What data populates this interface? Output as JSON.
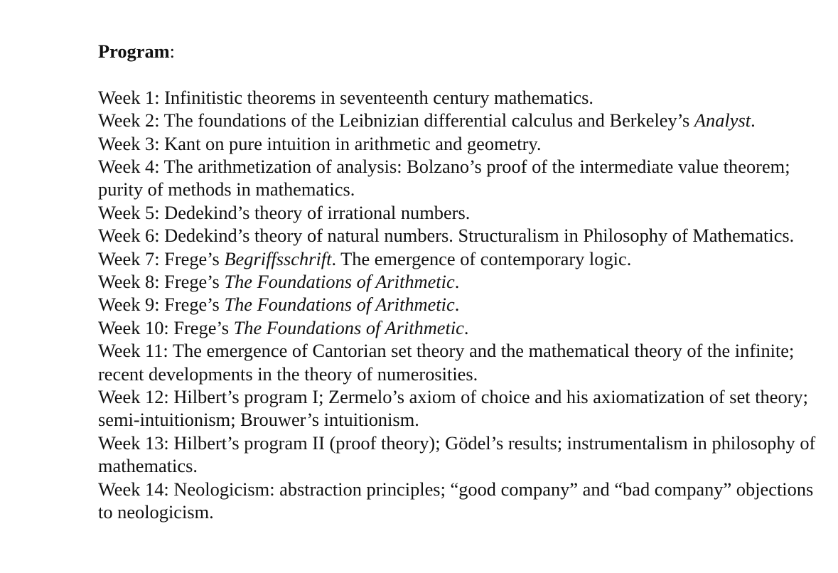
{
  "heading": {
    "label": "Program",
    "colon": ":"
  },
  "weeks": [
    {
      "parts": [
        {
          "text": "Week 1: Infinitistic theorems in seventeenth century mathematics.",
          "italic": false
        }
      ]
    },
    {
      "parts": [
        {
          "text": "Week 2: The foundations of the Leibnizian differential calculus and Berkeley’s ",
          "italic": false
        },
        {
          "text": "Analyst",
          "italic": true
        },
        {
          "text": ".",
          "italic": false
        }
      ]
    },
    {
      "parts": [
        {
          "text": "Week 3: Kant on pure intuition in arithmetic and geometry.",
          "italic": false
        }
      ]
    },
    {
      "parts": [
        {
          "text": "Week 4: The arithmetization of analysis: Bolzano’s proof of the intermediate value theorem; purity of methods in mathematics.",
          "italic": false
        }
      ]
    },
    {
      "parts": [
        {
          "text": "Week 5: Dedekind’s theory of irrational numbers.",
          "italic": false
        }
      ]
    },
    {
      "parts": [
        {
          "text": "Week 6: Dedekind’s theory of natural numbers. Structuralism in Philosophy of Mathematics.",
          "italic": false
        }
      ]
    },
    {
      "parts": [
        {
          "text": "Week 7: Frege’s ",
          "italic": false
        },
        {
          "text": "Begriffsschrift",
          "italic": true
        },
        {
          "text": ". The emergence of contemporary logic.",
          "italic": false
        }
      ]
    },
    {
      "parts": [
        {
          "text": "Week 8: Frege’s ",
          "italic": false
        },
        {
          "text": "The Foundations of Arithmetic",
          "italic": true
        },
        {
          "text": ".",
          "italic": false
        }
      ]
    },
    {
      "parts": [
        {
          "text": "Week 9: Frege’s ",
          "italic": false
        },
        {
          "text": "The Foundations of Arithmetic",
          "italic": true
        },
        {
          "text": ".",
          "italic": false
        }
      ]
    },
    {
      "parts": [
        {
          "text": "Week 10: Frege’s ",
          "italic": false
        },
        {
          "text": "The Foundations of Arithmetic",
          "italic": true
        },
        {
          "text": ".",
          "italic": false
        }
      ]
    },
    {
      "parts": [
        {
          "text": "Week 11: The emergence of Cantorian set theory and the mathematical theory of the infinite; recent developments in the theory of numerosities.",
          "italic": false
        }
      ]
    },
    {
      "parts": [
        {
          "text": "Week 12: Hilbert’s program I; Zermelo’s axiom of choice and his axiomatization of set theory; semi-intuitionism; Brouwer’s intuitionism.",
          "italic": false
        }
      ]
    },
    {
      "parts": [
        {
          "text": "Week 13: Hilbert’s program II (proof theory); Gödel’s results; instrumentalism in philosophy of mathematics.",
          "italic": false
        }
      ]
    },
    {
      "parts": [
        {
          "text": "Week 14: Neologicism: abstraction principles; “good company” and “bad company” objections to neologicism.",
          "italic": false
        }
      ]
    }
  ]
}
